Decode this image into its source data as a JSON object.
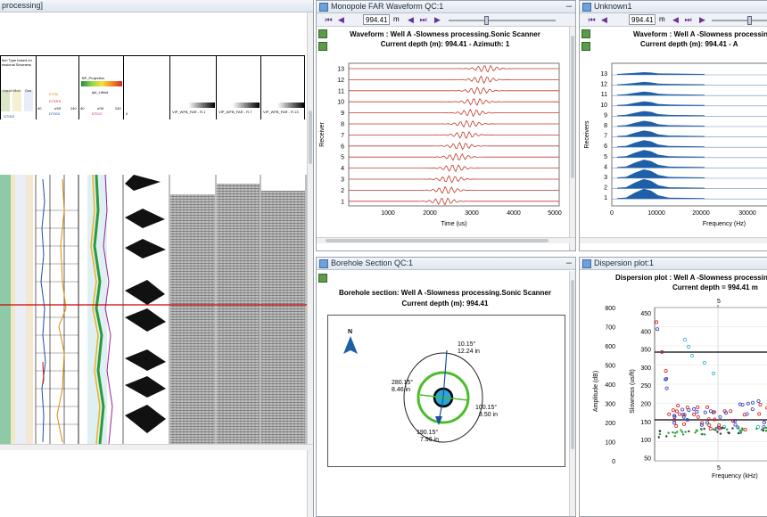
{
  "left_window": {
    "title": "processing]",
    "track_headers": {
      "col1_title": "tion Type based on\nessional Slowness",
      "col1_small": [
        "Liquid",
        "Mod",
        "Gas"
      ],
      "col1_scale": "DT003",
      "col1_scale_vals": [
        "140",
        "40"
      ],
      "col2_sub": [
        "DTS0",
        "DT1RS",
        "DT003"
      ],
      "col2_scale_vals": [
        "40",
        "uS/f",
        "240"
      ],
      "col3_sub": [
        "BP_Projection",
        "ipb_Lifesd",
        "DTCO"
      ],
      "col3_scale_vals": [
        "40",
        "uS/f",
        "240"
      ],
      "col4_label": "VIP_WFB_FAR - R.1",
      "col5_label": "VIP_WFB_FAR - R.7",
      "col6_label": "VIP_WFB_FAR - R.13",
      "scale_vals_small": [
        "0",
        "uS",
        "5"
      ]
    }
  },
  "waveform_window": {
    "title": "Monopole FAR Waveform QC:1",
    "depth": "994.41",
    "unit": "m",
    "chart_title": "Waveform : Well A -Slowness processing.Sonic Scanner",
    "chart_subtitle": "Current depth (m): 994.41 - Azimuth: 1",
    "ylabel": "Receiver",
    "xlabel": "Time (us)",
    "yticks": [
      "13",
      "12",
      "11",
      "10",
      "9",
      "8",
      "7",
      "6",
      "5",
      "4",
      "3",
      "2",
      "1"
    ],
    "xticks": [
      "1000",
      "2000",
      "3000",
      "4000",
      "5000"
    ]
  },
  "spectrum_window": {
    "title": "Unknown1",
    "depth": "994.41",
    "unit": "m",
    "chart_title": "Waveform : Well A -Slowness processing.S",
    "chart_subtitle": "Current depth (m): 994.41 - A",
    "ylabel": "Receivers",
    "xlabel": "Frequency (Hz)",
    "yticks": [
      "13",
      "12",
      "11",
      "10",
      "9",
      "8",
      "7",
      "6",
      "5",
      "4",
      "3",
      "2",
      "1"
    ],
    "xticks": [
      "0",
      "10000",
      "20000",
      "30000"
    ]
  },
  "borehole_window": {
    "title": "Borehole Section QC:1",
    "chart_title": "Borehole section: Well A -Slowness processing.Sonic Scanner",
    "chart_subtitle": "Current depth (m): 994.41",
    "north": "N",
    "labels": [
      {
        "deg": "10.15°",
        "dist": "12.24 in"
      },
      {
        "deg": "280.15°",
        "dist": "8.46 in"
      },
      {
        "deg": "100.15°",
        "dist": "8.50 in"
      },
      {
        "deg": "190.15°",
        "dist": "7.96 in"
      }
    ]
  },
  "dispersion_window": {
    "title": "Dispersion plot:1",
    "chart_title": "Dispersion plot : Well A -Slowness processing_",
    "chart_subtitle": "Current depth = 994.41 m",
    "top_tick": "5",
    "bottom_tick": "5",
    "amp_label": "Amplitude (dB)",
    "slow_label": "Slowness (us/ft)",
    "xlabel": "Frequency (kHz)",
    "amp_ticks": [
      "800",
      "700",
      "600",
      "500",
      "400",
      "300",
      "200",
      "100",
      "0"
    ],
    "slow_ticks": [
      "450",
      "400",
      "350",
      "300",
      "250",
      "200",
      "150",
      "100",
      "50"
    ]
  },
  "colors": {
    "accent_purple": "#6a2fa0",
    "red_line": "#d00000",
    "wave_red": "#c0392b",
    "spectrum_blue": "#1f5fa8",
    "ring_green": "#4bbd2a"
  }
}
